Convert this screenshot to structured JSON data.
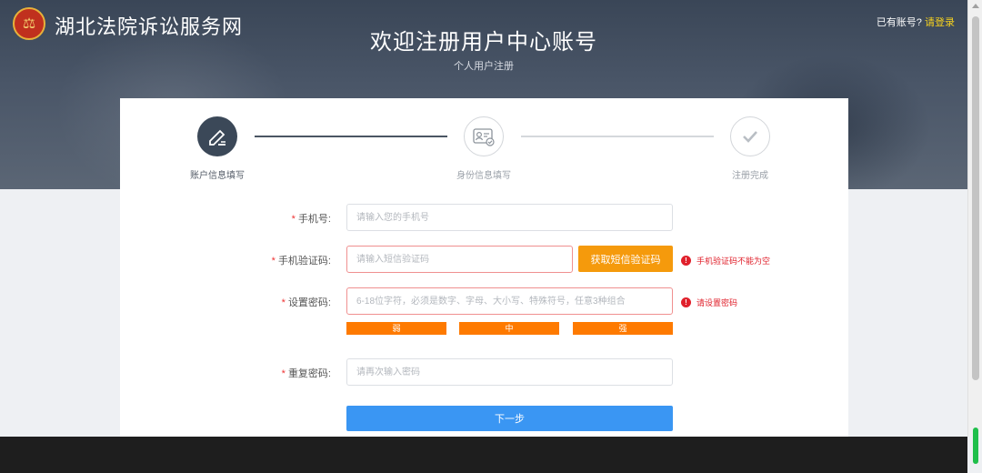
{
  "header": {
    "site_name": "湖北法院诉讼服务网",
    "title": "欢迎注册用户中心账号",
    "subtitle": "个人用户注册",
    "login_prompt": "已有账号?",
    "login_link": "请登录"
  },
  "steps": [
    {
      "label": "账户信息填写",
      "icon": "pencil-icon",
      "active": true
    },
    {
      "label": "身份信息填写",
      "icon": "id-card-icon",
      "active": false
    },
    {
      "label": "注册完成",
      "icon": "checkmark-icon",
      "active": false
    }
  ],
  "form": {
    "phone": {
      "label": "手机号:",
      "placeholder": "请输入您的手机号",
      "value": ""
    },
    "sms_code": {
      "label": "手机验证码:",
      "placeholder": "请输入短信验证码",
      "value": "",
      "error": "手机验证码不能为空"
    },
    "sms_button": "获取短信验证码",
    "password": {
      "label": "设置密码:",
      "placeholder": "6-18位字符，必须是数字、字母、大小写、特殊符号，任意3种组合",
      "value": "",
      "error": "请设置密码"
    },
    "strength": [
      "弱",
      "中",
      "强"
    ],
    "confirm": {
      "label": "重复密码:",
      "placeholder": "请再次输入密码",
      "value": ""
    },
    "next_button": "下一步"
  },
  "colors": {
    "accent_blue": "#3a96f3",
    "sms_orange": "#f59a0c",
    "strength_orange": "#fe7a00",
    "error_red": "#e0202b",
    "step_active": "#3b4858"
  }
}
